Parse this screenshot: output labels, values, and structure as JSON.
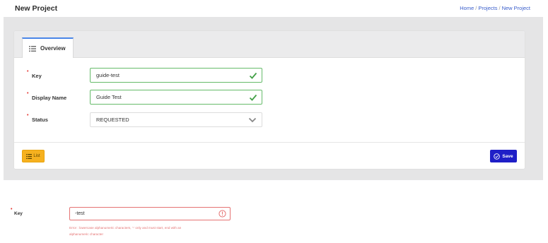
{
  "header": {
    "title": "New Project",
    "breadcrumb": [
      "Home",
      "Projects",
      "New Project"
    ]
  },
  "tabs": [
    {
      "label": "Overview",
      "icon": "list-icon",
      "active": true
    }
  ],
  "form": {
    "fields": [
      {
        "label": "Key",
        "value": "guide-test",
        "required": true,
        "state": "valid"
      },
      {
        "label": "Display Name",
        "value": "Guide Test",
        "required": true,
        "state": "valid"
      },
      {
        "label": "Status",
        "value": "REQUESTED",
        "required": true,
        "type": "select"
      }
    ]
  },
  "buttons": {
    "list_label": "List",
    "save_label": "Save"
  },
  "error_example": {
    "label": "Key",
    "value": "-test",
    "error_line1": "Error : lowercase alphanumeric characters, '-' only and must start, end with an",
    "error_line2": "alphanumeric character"
  },
  "colors": {
    "accent": "#1f1fc7",
    "warning_button": "#f6b11f",
    "valid": "#4caf50",
    "error": "#e57373",
    "required": "#e53935",
    "link": "#3a5ecb"
  }
}
